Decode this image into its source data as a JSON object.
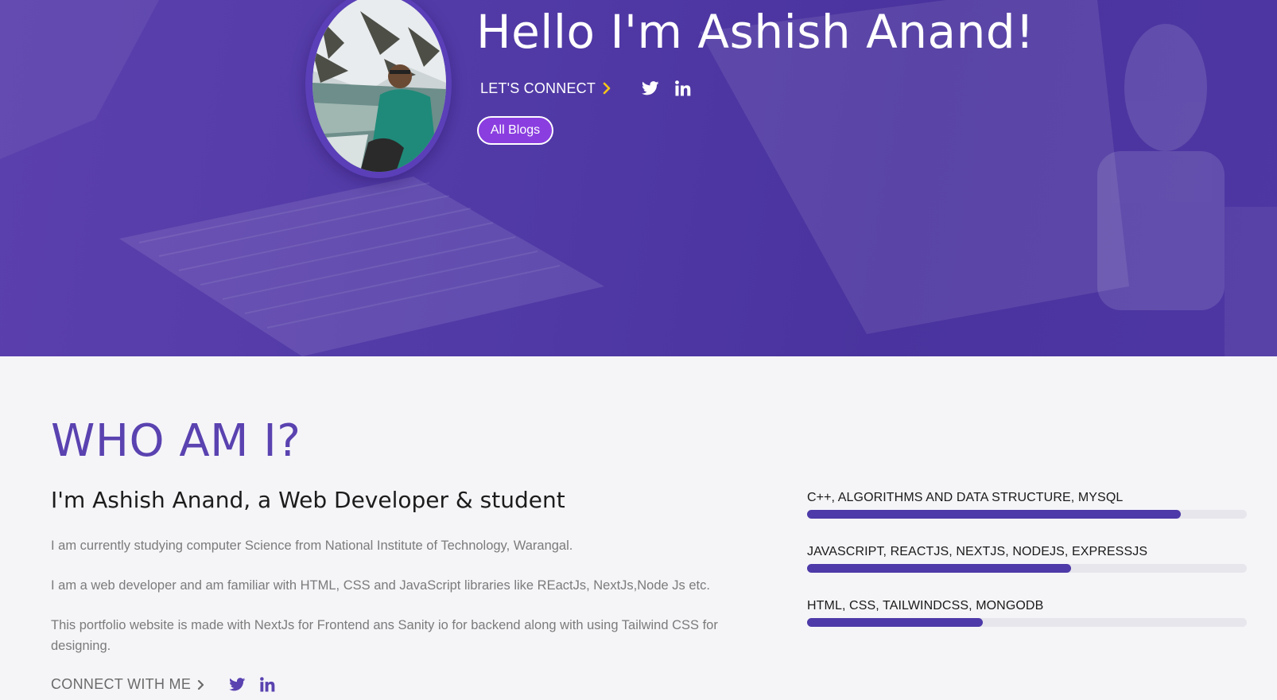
{
  "hero": {
    "title": "Hello I'm Ashish Anand!",
    "connect_label": "LET'S CONNECT",
    "blogs_button": "All Blogs",
    "social": [
      "twitter-icon",
      "linkedin-icon"
    ]
  },
  "about": {
    "heading": "WHO AM I?",
    "subtitle": "I'm Ashish Anand, a Web Developer & student",
    "paragraphs": [
      "I am currently studying computer Science from National Institute of Technology, Warangal.",
      "I am a web developer and am familiar with HTML, CSS and JavaScript libraries like REactJs, NextJs,Node Js etc.",
      "This portfolio website is made with NextJs for Frontend ans Sanity io for backend along with using Tailwind CSS for designing."
    ],
    "connect_label": "CONNECT WITH ME"
  },
  "skills": [
    {
      "label": "C++, ALGORITHMS AND DATA STRUCTURE, MYSQL",
      "level": 0.85
    },
    {
      "label": "JAVASCRIPT, REACTJS, NEXTJS, NODEJS, EXPRESSJS",
      "level": 0.6
    },
    {
      "label": "HTML, CSS, TAILWINDCSS, MONGODB",
      "level": 0.4
    }
  ],
  "colors": {
    "hero_bg": "#5140a8",
    "accent": "#5a42b0",
    "button": "#8a3ee0",
    "chevron": "#f5c518",
    "bar_fill": "#4e3aa8",
    "bar_track": "#e6e6ec"
  }
}
